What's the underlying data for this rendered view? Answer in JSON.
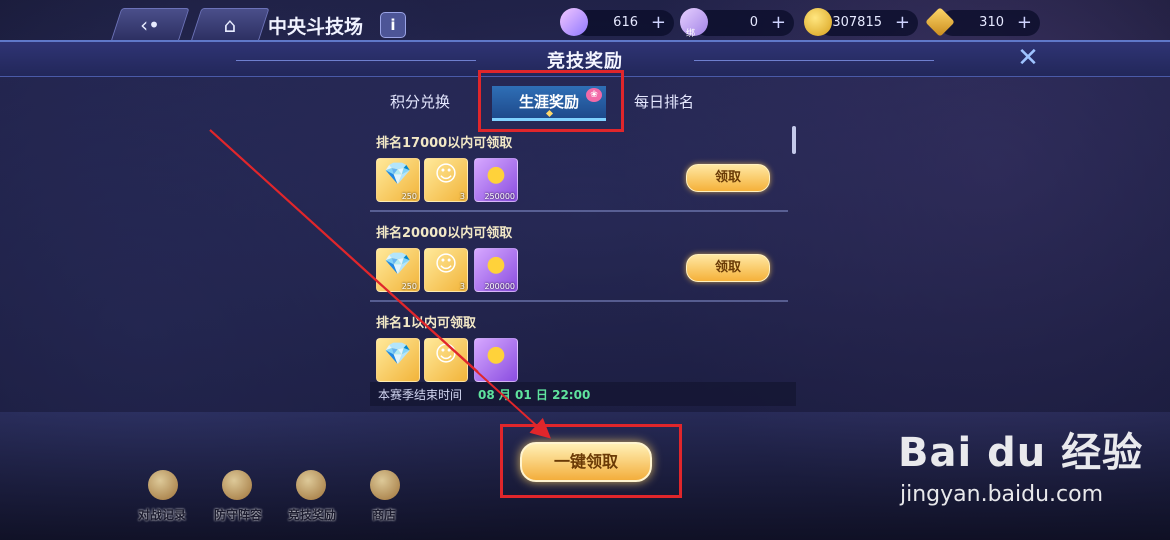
{
  "header": {
    "back_icon": "back-arrow-icon",
    "home_icon": "home-icon",
    "page_title": "中央斗技场",
    "info_label": "i",
    "resources": [
      {
        "name": "crystal",
        "value": "616",
        "plus": "+",
        "color": "#b995ff"
      },
      {
        "name": "crystal-bound",
        "value": "0",
        "plus": "+",
        "color": "#c9a3ff",
        "sub": "绑"
      },
      {
        "name": "gold-coin",
        "value": "307815",
        "plus": "+",
        "color": "#f5c531"
      },
      {
        "name": "stamina",
        "value": "310",
        "plus": "+",
        "color": "#e5b94f"
      }
    ]
  },
  "dialog": {
    "title": "竞技奖励",
    "close_icon": "close-icon",
    "tabs": [
      {
        "label": "积分兑换"
      },
      {
        "label": "生涯奖励"
      },
      {
        "label": "每日排名"
      }
    ],
    "rewards": [
      {
        "title": "排名17000以内可领取",
        "items": [
          {
            "count": "250"
          },
          {
            "count": "3"
          },
          {
            "count": "250000"
          }
        ],
        "button": "领取"
      },
      {
        "title": "排名20000以内可领取",
        "items": [
          {
            "count": "250"
          },
          {
            "count": "3"
          },
          {
            "count": "200000"
          }
        ],
        "button": "领取"
      },
      {
        "title": "排名1以内可领取",
        "items": [
          {
            "count": ""
          },
          {
            "count": ""
          },
          {
            "count": ""
          }
        ],
        "button": ""
      }
    ],
    "season_label": "本赛季结束时间",
    "season_time": "08 月 01 日 22:00"
  },
  "bottom": {
    "claim_all": "一键领取",
    "nav": [
      "对战记录",
      "防守阵容",
      "竞技奖励",
      "商店"
    ]
  },
  "watermark": {
    "logo": "Bai du 经验",
    "url": "jingyan.baidu.com"
  },
  "colors": {
    "highlight": "#e0262b",
    "arrow": "#e0262b",
    "accent_gold": "#f5b13a",
    "season_green": "#5fe39e"
  }
}
